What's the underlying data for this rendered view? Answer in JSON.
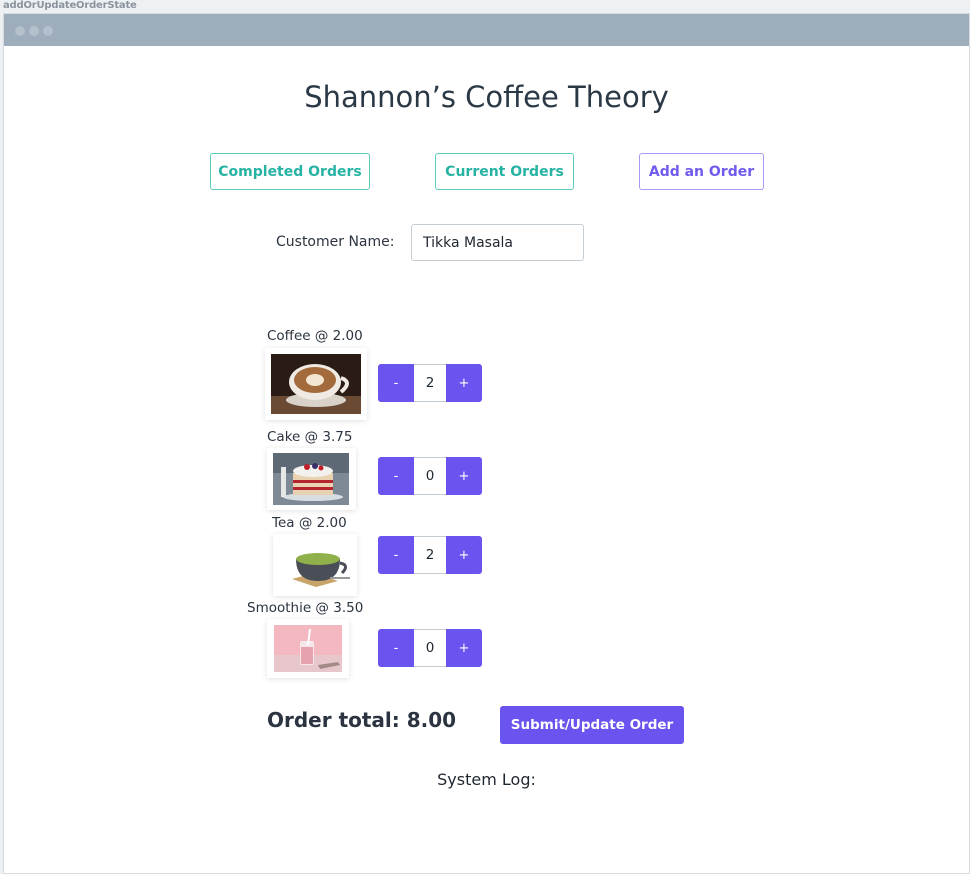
{
  "caption": "addOrUpdateOrderState",
  "app": {
    "title": "Shannon’s Coffee Theory"
  },
  "nav": {
    "completed": "Completed Orders",
    "current": "Current Orders",
    "add": "Add an Order"
  },
  "customer": {
    "label": "Customer Name:",
    "value": "Tikka Masala"
  },
  "items": [
    {
      "label": "Coffee @ 2.00",
      "qty": "2",
      "minus": "-",
      "plus": "+",
      "image": "coffee-cup-photo"
    },
    {
      "label": "Cake @ 3.75",
      "qty": "0",
      "minus": "-",
      "plus": "+",
      "image": "layer-cake-photo"
    },
    {
      "label": "Tea @ 2.00",
      "qty": "2",
      "minus": "-",
      "plus": "+",
      "image": "tea-cup-photo"
    },
    {
      "label": "Smoothie @ 3.50",
      "qty": "0",
      "minus": "-",
      "plus": "+",
      "image": "smoothie-glass-photo"
    }
  ],
  "order": {
    "total_label": "Order total: 8.00",
    "submit": "Submit/Update Order"
  },
  "log": {
    "label": "System Log:"
  },
  "colors": {
    "accent": "#6a54f0",
    "teal": "#26b3a4",
    "titlebar": "#9eadbb"
  }
}
